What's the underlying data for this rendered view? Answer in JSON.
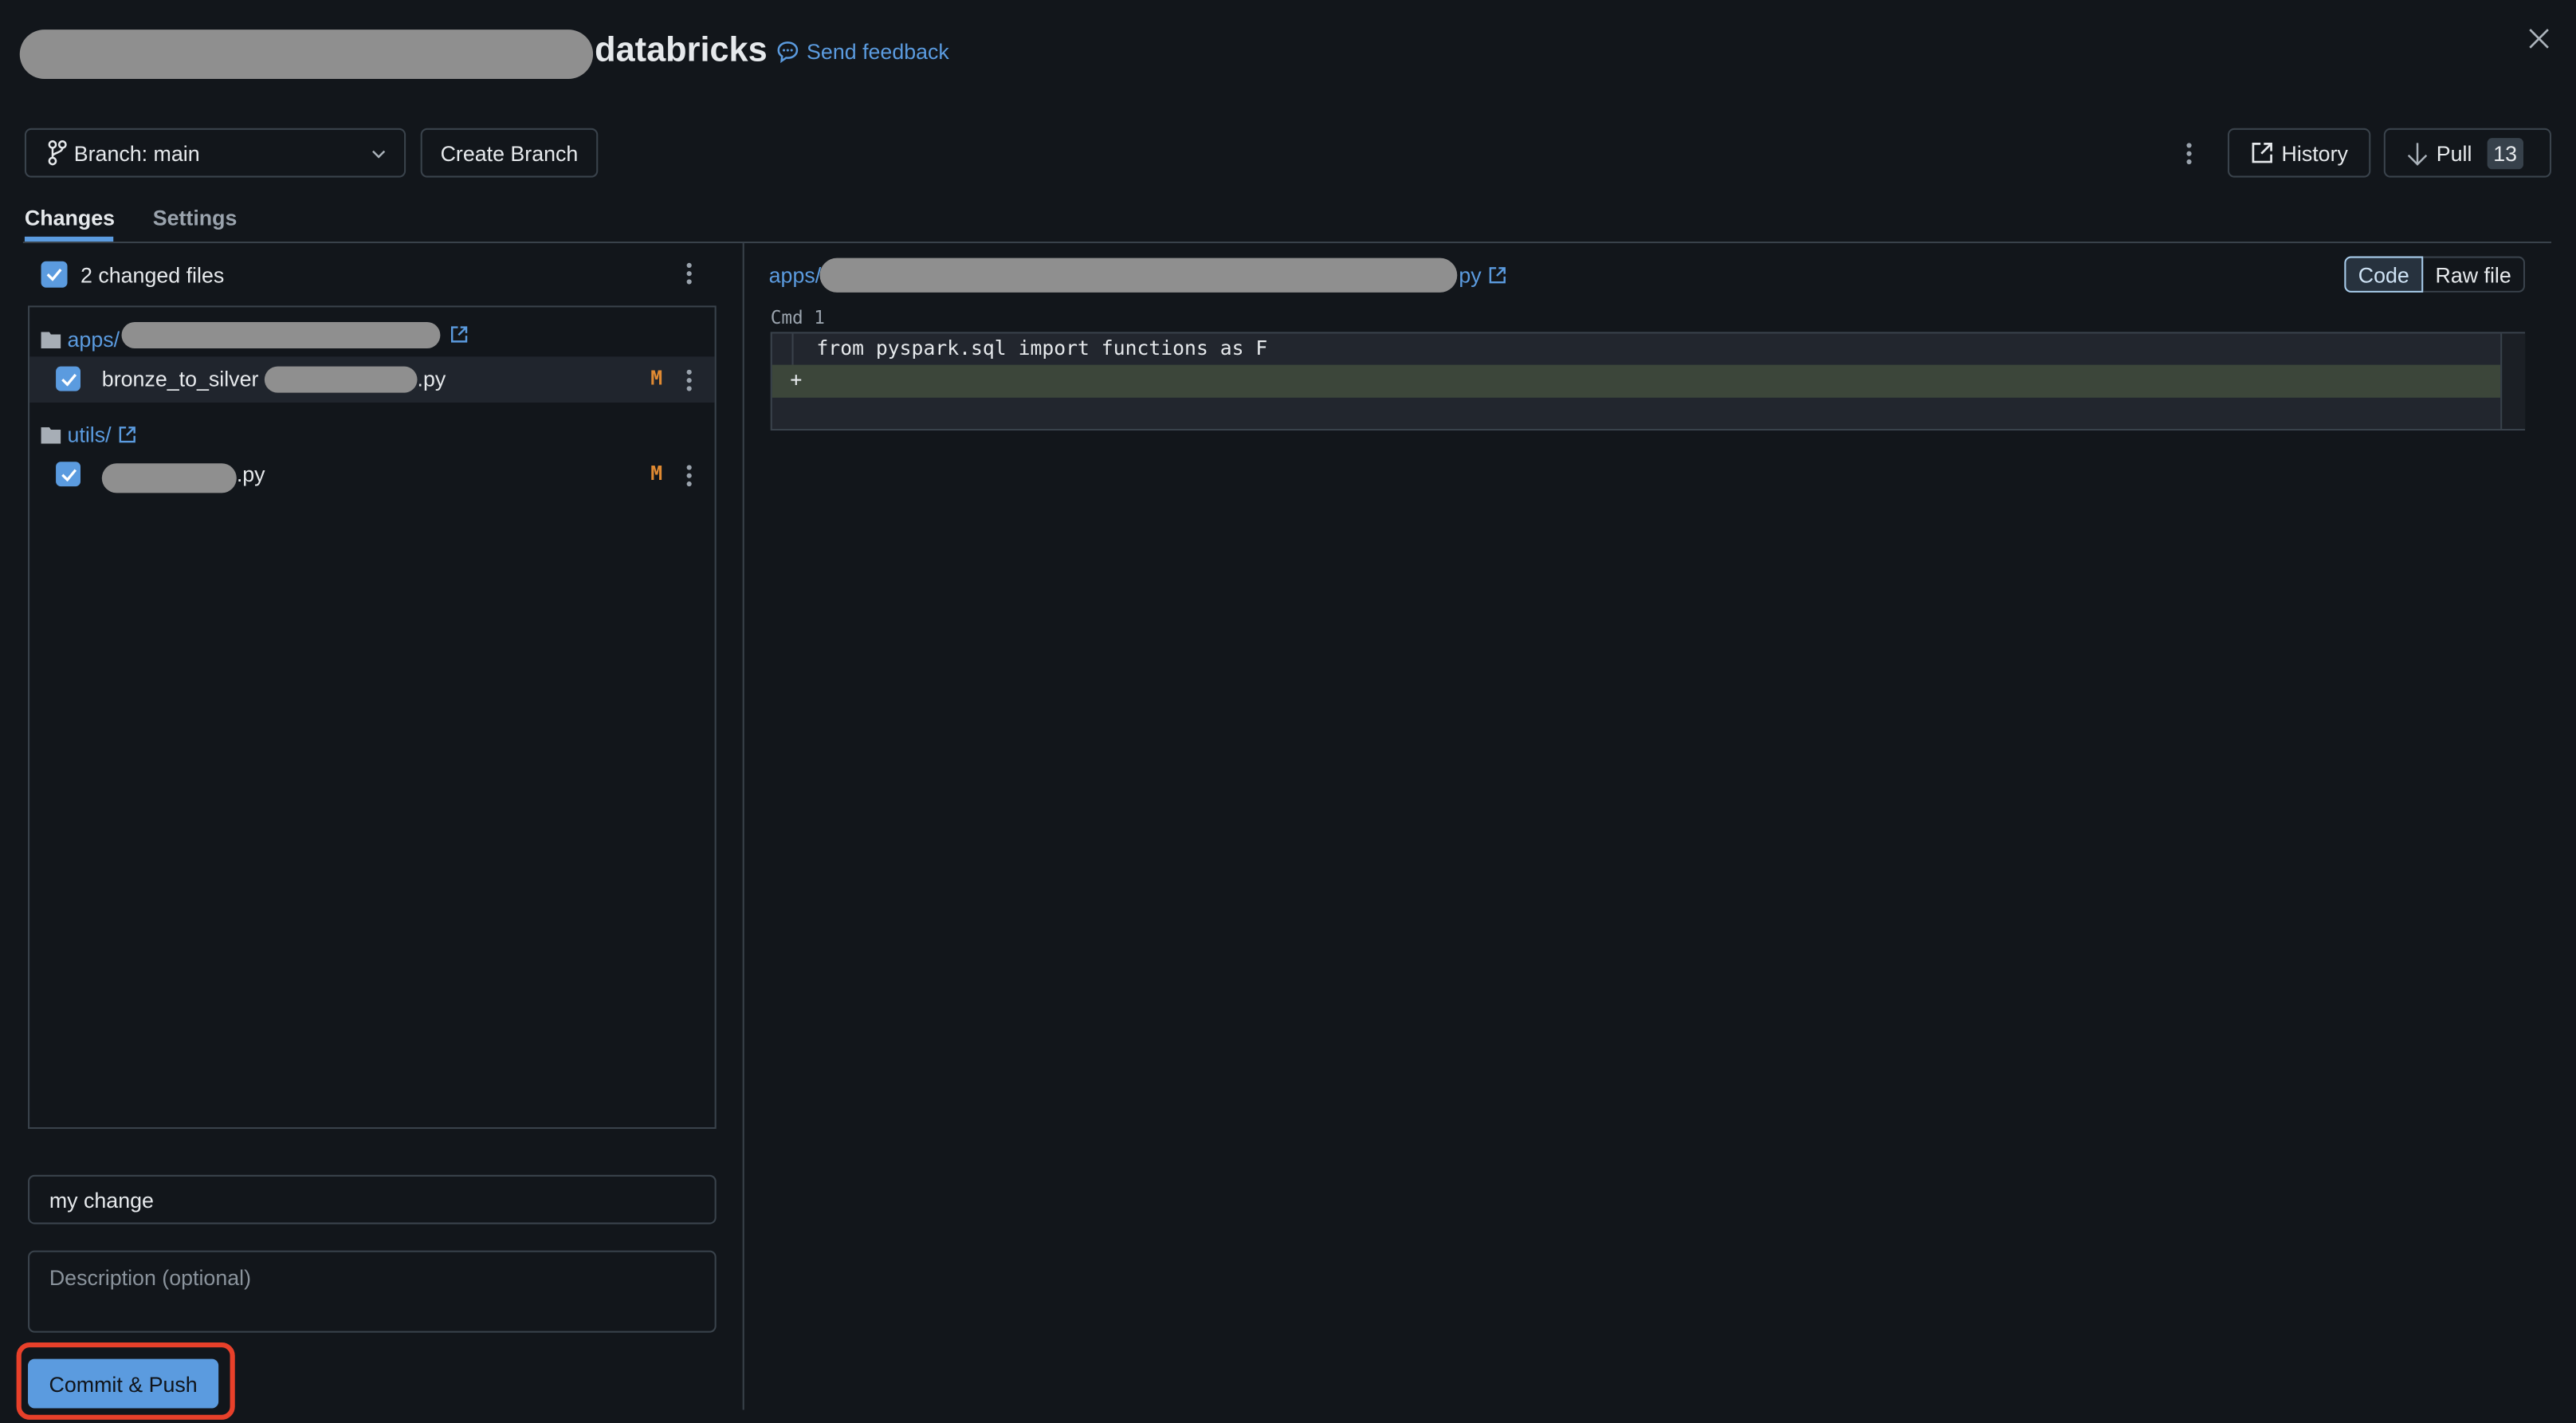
{
  "header": {
    "title_suffix": "databricks",
    "feedback_label": "Send feedback",
    "close_icon": "close-icon"
  },
  "toolbar": {
    "branch_label": "Branch: main",
    "create_branch_label": "Create Branch",
    "history_label": "History",
    "pull_label": "Pull",
    "pull_count": "13"
  },
  "tabs": [
    {
      "label": "Changes",
      "active": true
    },
    {
      "label": "Settings",
      "active": false
    }
  ],
  "changes": {
    "summary": "2 changed files",
    "groups": [
      {
        "folder": "apps/",
        "files": [
          {
            "name_prefix": "bronze_to_silver",
            "name_suffix": ".py",
            "status": "M",
            "checked": true
          }
        ]
      },
      {
        "folder": "utils/",
        "files": [
          {
            "name_prefix": "",
            "name_suffix": ".py",
            "status": "M",
            "checked": true
          }
        ]
      }
    ],
    "commit_message": "my change",
    "description_placeholder": "Description (optional)",
    "commit_button": "Commit & Push"
  },
  "diff": {
    "path_prefix": "apps/",
    "path_suffix": "py",
    "view_options": [
      "Code",
      "Raw file"
    ],
    "selected_view": "Code",
    "cell_label": "Cmd 1",
    "lines": [
      {
        "marker": "",
        "text": "from pyspark.sql import functions as F"
      },
      {
        "marker": "+",
        "text": ""
      }
    ]
  },
  "colors": {
    "accent": "#5b9bdf",
    "modified": "#e08a32",
    "added_line": "#3c463a",
    "highlight": "#e8402a"
  }
}
